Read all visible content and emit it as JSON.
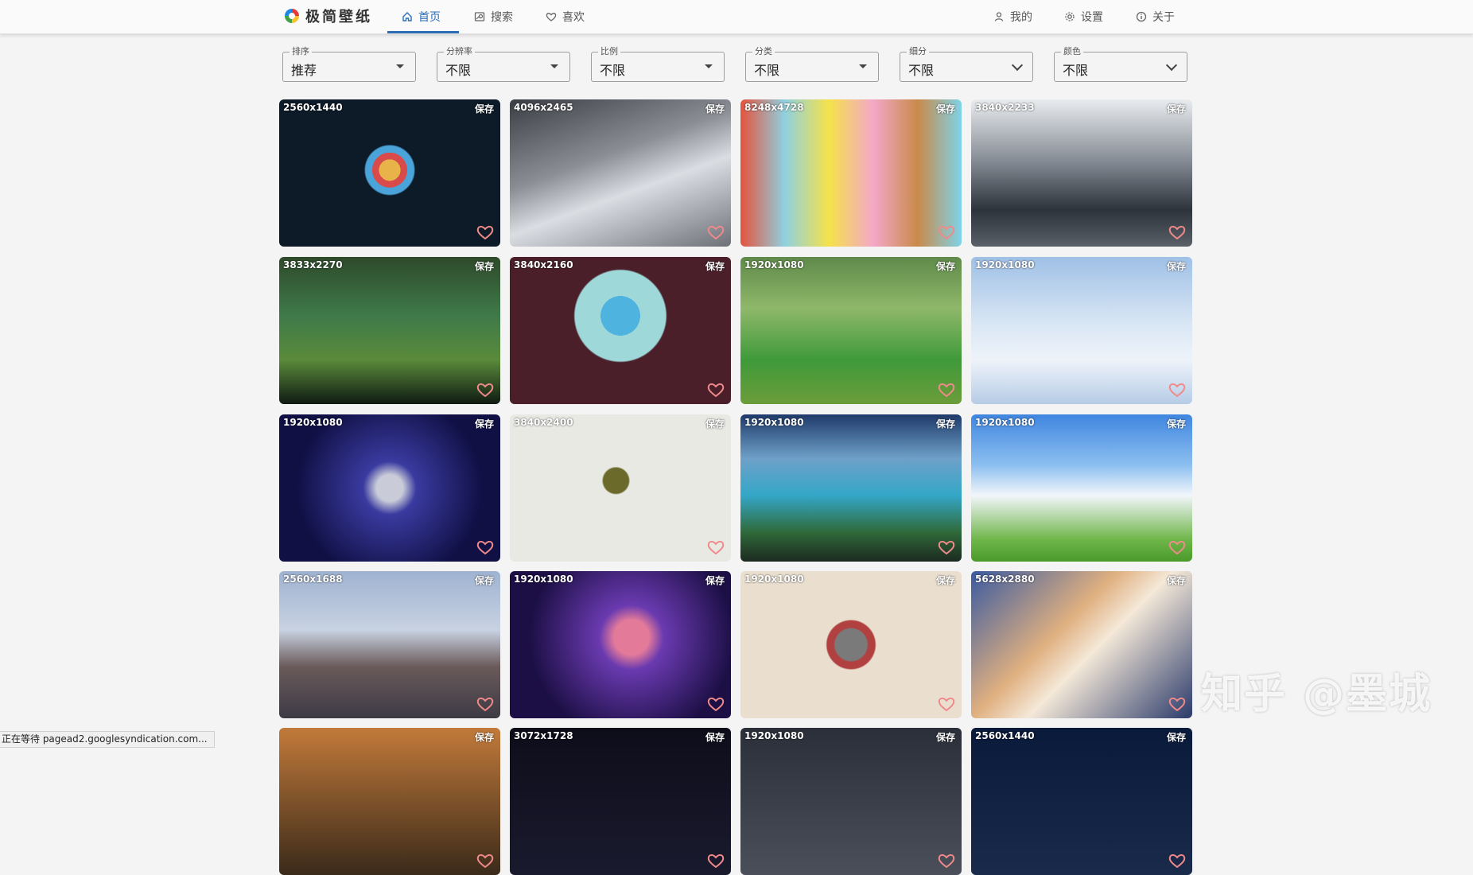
{
  "app": {
    "name": "极简壁纸"
  },
  "nav": {
    "home": "首页",
    "search": "搜索",
    "favorites": "喜欢",
    "mine": "我的",
    "settings": "设置",
    "about": "关于"
  },
  "filters": [
    {
      "label": "排序",
      "value": "推荐"
    },
    {
      "label": "分辨率",
      "value": "不限"
    },
    {
      "label": "比例",
      "value": "不限"
    },
    {
      "label": "分类",
      "value": "不限"
    },
    {
      "label": "细分",
      "value": "不限"
    },
    {
      "label": "颜色",
      "value": "不限"
    }
  ],
  "cards": [
    {
      "res": "2560x1440",
      "save": "保存",
      "bg": "radial-gradient(circle at 50% 48%, #e8b44a 0 8%, #d94a4a 8% 13%, #4aa3d9 13% 18%, #0d1a27 19%)"
    },
    {
      "res": "4096x2465",
      "save": "保存",
      "bg": "linear-gradient(160deg,#3a3d44 0%,#8b8e94 40%,#dadde2 60%,#6d7077 100%)"
    },
    {
      "res": "8248x4728",
      "save": "保存",
      "bg": "linear-gradient(90deg,#e5533d 0%,#8fd0e0 20%,#f5e24a 40%,#f4a8c8 60%,#c98a4a 80%,#7fd3e8 100%)"
    },
    {
      "res": "3840x2233",
      "save": "保存",
      "bg": "linear-gradient(180deg,#e9ecef 0%,#8a9099 40%,#2d333b 75%,#5a6068 100%)"
    },
    {
      "res": "3833x2270",
      "save": "保存",
      "bg": "linear-gradient(180deg,#2e4a2a 0%,#3f7a4a 40%,#5a8a3a 70%,#0f1a12 100%)"
    },
    {
      "res": "3840x2160",
      "save": "保存",
      "bg": "radial-gradient(circle at 50% 40%, #4fb3e0 0 14%, #9fd8d9 14% 32%, #4a1f2a 33%)"
    },
    {
      "res": "1920x1080",
      "save": "保存",
      "bg": "linear-gradient(180deg,#5f8a4a 0%,#8fb86a 35%,#3f9a3a 70%,#6c9c3a 100%)"
    },
    {
      "res": "1920x1080",
      "save": "保存",
      "bg": "linear-gradient(180deg,#9fc0e6 0%,#d8e6f4 45%,#eef3fa 70%,#b6cce6 100%)"
    },
    {
      "res": "1920x1080",
      "save": "保存",
      "bg": "radial-gradient(circle at 50% 50%, #c9ccd8 0 10%, #3a3aa0 20%, #101045 70%)"
    },
    {
      "res": "3840x2400",
      "save": "保存",
      "bg": "radial-gradient(circle at 48% 45%, #6b6a2a 0 9%, #e9e9e4 10%)"
    },
    {
      "res": "1920x1080",
      "save": "保存",
      "bg": "linear-gradient(180deg,#1f3a6a 0%,#6ea0c8 30%,#34a7c8 55%,#2f6a3a 80%,#1c2a20 100%)"
    },
    {
      "res": "1920x1080",
      "save": "保存",
      "bg": "linear-gradient(180deg,#3f86e0 0%,#8ec0f0 35%,#f2f6fb 55%,#6fb64a 85%,#4a9a2a 100%)"
    },
    {
      "res": "2560x1688",
      "save": "保存",
      "bg": "linear-gradient(180deg,#9fb3d0 0%,#c8d2e2 40%,#6a5a5a 65%,#3d3a44 100%)"
    },
    {
      "res": "1920x1080",
      "save": "保存",
      "bg": "radial-gradient(circle at 55% 45%, #e37a9a 0 12%, #6a3ab0 22%, #1c0f45 70%)"
    },
    {
      "res": "1920x1080",
      "save": "保存",
      "bg": "radial-gradient(circle at 50% 50%, #7a7a7a 0 12%, #b14040 13% 18%, #eadfcf 19%)"
    },
    {
      "res": "5628x2880",
      "save": "保存",
      "bg": "linear-gradient(135deg,#3a5aa0 0%,#e0b080 40%,#f4e8d8 55%,#2a3a6a 100%)"
    },
    {
      "res": "",
      "save": "保存",
      "bg": "linear-gradient(180deg,#c27a3a 0%,#3a2a1a 100%)"
    },
    {
      "res": "3072x1728",
      "save": "保存",
      "bg": "linear-gradient(180deg,#0d0d1a 0%,#1a1a2e 100%)"
    },
    {
      "res": "1920x1080",
      "save": "保存",
      "bg": "linear-gradient(180deg,#2a2f3a 0%,#4a4f5a 100%)"
    },
    {
      "res": "2560x1440",
      "save": "保存",
      "bg": "linear-gradient(180deg,#0a1a3a 0%,#1a2a4a 100%)"
    }
  ],
  "status_bar": "正在等待 pagead2.googlesyndication.com...",
  "watermark": "知乎 @墨城",
  "colors": {
    "accent": "#2c6db4",
    "heart": "#f08a8a"
  }
}
